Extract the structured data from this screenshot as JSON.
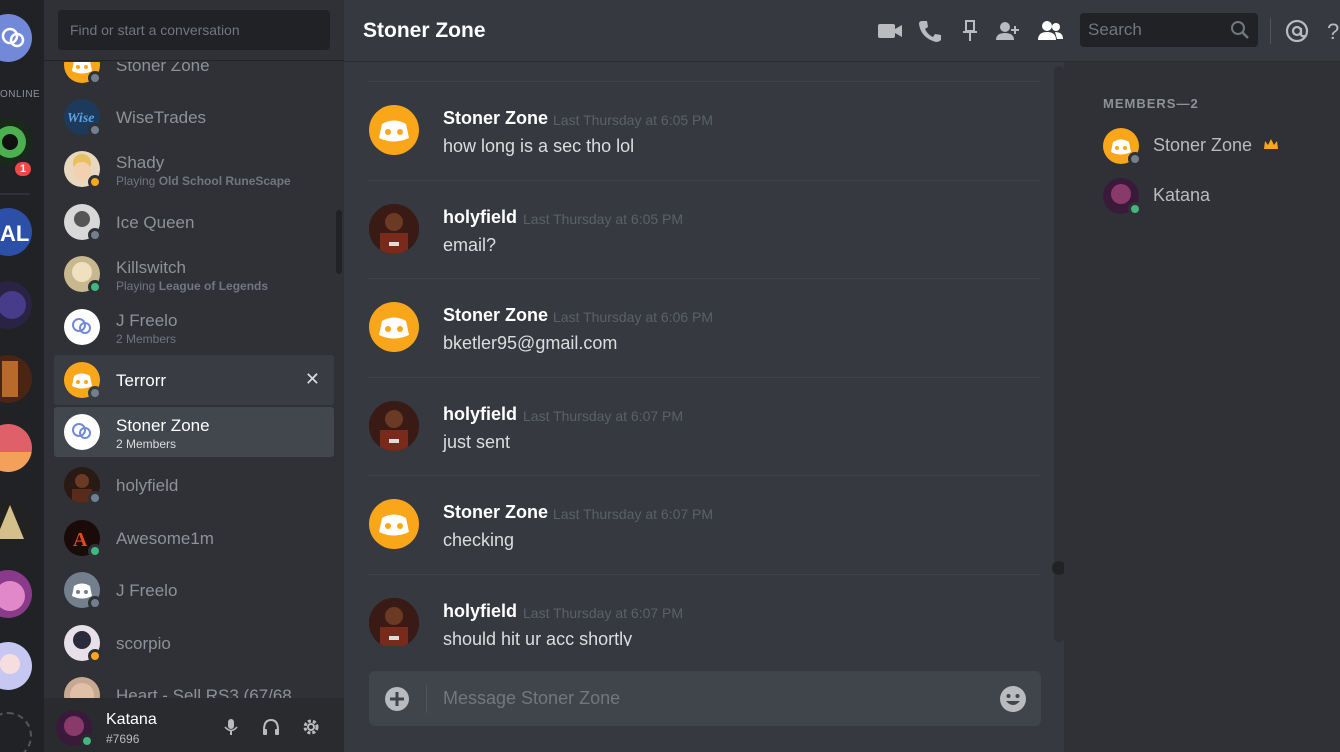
{
  "guild_rail": {
    "online_label": "ONLINE",
    "badge_count": "1"
  },
  "dm_panel": {
    "search_placeholder": "Find or start a conversation",
    "items": [
      {
        "name": "Stoner Zone"
      },
      {
        "name": "WiseTrades"
      },
      {
        "name": "Shady",
        "activity_prefix": "Playing ",
        "activity_game": "Old School RuneScape"
      },
      {
        "name": "Ice Queen"
      },
      {
        "name": "Killswitch",
        "activity_prefix": "Playing ",
        "activity_game": "League of Legends"
      },
      {
        "name": "J Freelo",
        "sub": "2 Members"
      },
      {
        "name": "Terrorr",
        "close": "✕"
      },
      {
        "name": "Stoner Zone",
        "sub": "2 Members"
      },
      {
        "name": "holyfield"
      },
      {
        "name": "Awesome1m"
      },
      {
        "name": "J Freelo"
      },
      {
        "name": "scorpio"
      },
      {
        "name": "Heart - Sell RS3 (67/68"
      }
    ]
  },
  "user_panel": {
    "username": "Katana",
    "discriminator": "#7696"
  },
  "header": {
    "title": "Stoner Zone",
    "search_placeholder": "Search"
  },
  "messages": [
    {
      "author": "Stoner Zone",
      "timestamp": "Last Thursday at 6:05 PM",
      "text": "how long is a sec tho lol"
    },
    {
      "author": "holyfield",
      "timestamp": "Last Thursday at 6:05 PM",
      "text": "email?"
    },
    {
      "author": "Stoner Zone",
      "timestamp": "Last Thursday at 6:06 PM",
      "text": "bketler95@gmail.com"
    },
    {
      "author": "holyfield",
      "timestamp": "Last Thursday at 6:07 PM",
      "text": "just sent"
    },
    {
      "author": "Stoner Zone",
      "timestamp": "Last Thursday at 6:07 PM",
      "text": "checking"
    },
    {
      "author": "holyfield",
      "timestamp": "Last Thursday at 6:07 PM",
      "text": "should hit ur acc shortly"
    }
  ],
  "composer": {
    "placeholder": "Message Stoner Zone"
  },
  "members": {
    "title": "MEMBERS—2",
    "list": [
      {
        "name": "Stoner Zone"
      },
      {
        "name": "Katana"
      }
    ]
  },
  "colors": {
    "brand": "#7289da",
    "discord_orange": "#faa61a",
    "online": "#43b581",
    "offline": "#747f8d",
    "danger": "#f04747"
  }
}
